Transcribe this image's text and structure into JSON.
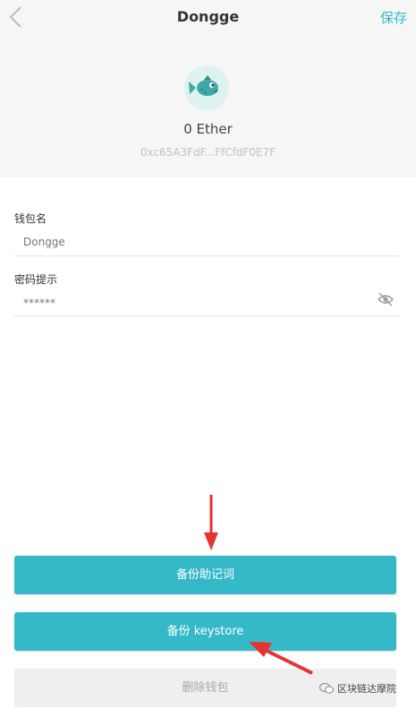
{
  "nav": {
    "title": "Dongge",
    "save_label": "保存"
  },
  "wallet": {
    "balance": "0 Ether",
    "address": "0xc65A3FdF...FfCfdF0E7F"
  },
  "form": {
    "name_label": "钱包名",
    "name_value": "Dongge",
    "hint_label": "密码提示",
    "hint_value": "******"
  },
  "buttons": {
    "backup_mnemonic": "备份助记词",
    "backup_keystore": "备份 keystore",
    "delete_wallet": "删除钱包"
  },
  "watermark": {
    "text": "区块链达摩院"
  },
  "colors": {
    "accent": "#35b9c9",
    "arrow": "#e8322f"
  }
}
